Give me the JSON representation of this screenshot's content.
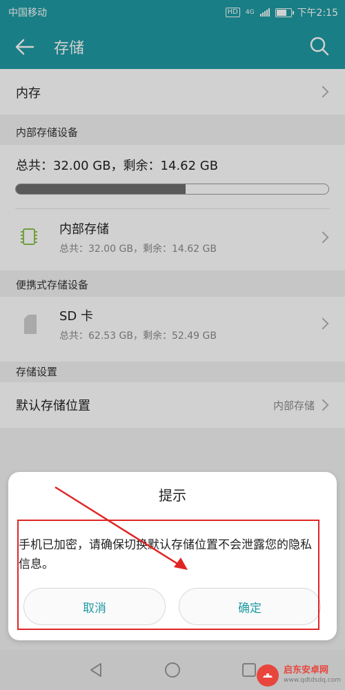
{
  "status_bar": {
    "carrier": "中国移动",
    "hd": "HD",
    "network": "4G",
    "time": "下午2:15"
  },
  "app_bar": {
    "title": "存储"
  },
  "memory_row": {
    "label": "内存"
  },
  "internal_section": {
    "header": "内部存储设备",
    "summary": "总共：32.00 GB，剩余：14.62 GB",
    "usage_fraction": 0.543,
    "device": {
      "title": "内部存储",
      "subtitle": "总共：32.00 GB，剩余：14.62 GB"
    }
  },
  "portable_section": {
    "header": "便携式存储设备",
    "device": {
      "title": "SD 卡",
      "subtitle": "总共：62.53 GB，剩余：52.49 GB"
    }
  },
  "settings_section": {
    "header": "存储设置",
    "default_location": {
      "label": "默认存储位置",
      "value": "内部存储"
    }
  },
  "dialog": {
    "title": "提示",
    "message": "手机已加密，请确保切换默认存储位置不会泄露您的隐私信息。",
    "cancel_label": "取消",
    "confirm_label": "确定"
  },
  "watermark": {
    "name": "启东安卓网",
    "url": "www.qdtdsdq.com"
  },
  "colors": {
    "accent": "#1f9aa3",
    "annotation": "#e02424"
  }
}
